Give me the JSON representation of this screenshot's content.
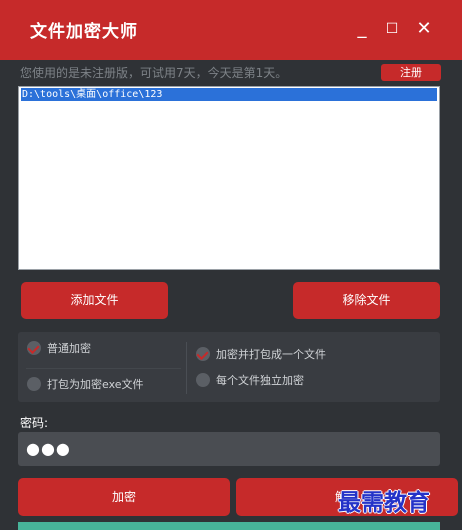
{
  "window": {
    "title": "文件加密大师",
    "min_glyph": "_",
    "max_glyph": "☐",
    "close_glyph": "✕"
  },
  "trial": {
    "notice": "您使用的是未注册版，可试用7天，今天是第1天。",
    "register_label": "注册"
  },
  "file_list": {
    "items": [
      "D:\\tools\\桌面\\office\\123"
    ]
  },
  "buttons": {
    "add_file": "添加文件",
    "remove_file": "移除文件",
    "encrypt": "加密",
    "decrypt": "解密"
  },
  "options": {
    "normal": {
      "label": "普通加密",
      "checked": true
    },
    "pack_exe": {
      "label": "打包为加密exe文件",
      "checked": false
    },
    "pack_one": {
      "label": "加密并打包成一个文件",
      "checked": true
    },
    "each": {
      "label": "每个文件独立加密",
      "checked": false
    }
  },
  "password": {
    "label": "密码:",
    "value": "●●●"
  },
  "watermark": "最需教育",
  "colors": {
    "accent": "#c62a2a",
    "background": "#2f3236",
    "selection": "#2b71d9",
    "progress": "#47b49a"
  }
}
